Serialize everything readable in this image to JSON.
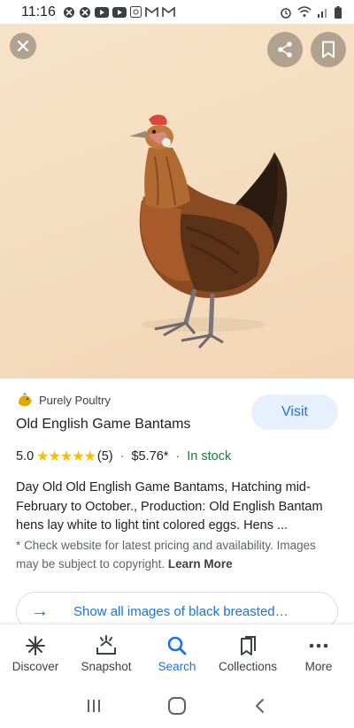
{
  "status_bar": {
    "time": "11:16",
    "left_icons": [
      "xbox-icon",
      "xbox-icon",
      "youtube-icon",
      "youtube-icon",
      "photo-icon",
      "gmail-icon",
      "gmail-icon"
    ],
    "right_icons": [
      "alarm-icon",
      "wifi-icon",
      "signal-icon",
      "battery-icon"
    ]
  },
  "image": {
    "subject": "hen-photo",
    "background_color": "#f5ddc0"
  },
  "result": {
    "source": "Purely Poultry",
    "title": "Old English Game Bantams",
    "visit_label": "Visit",
    "rating": "5.0",
    "stars": "★★★★★",
    "review_count": "(5)",
    "separator": "·",
    "price": "$5.76*",
    "availability": "In stock",
    "description": "Day Old Old English Game Bantams, Hatching mid-February to October., Production: Old English Bantam hens lay white to light tint colored eggs. Hens ...",
    "note": "* Check website for latest pricing and availability. Images may be subject to copyright.",
    "learn_more": "Learn More",
    "show_all": "Show all images of black breasted…"
  },
  "bottom_nav": {
    "items": [
      {
        "label": "Discover",
        "icon": "asterisk-icon"
      },
      {
        "label": "Snapshot",
        "icon": "snapshot-icon"
      },
      {
        "label": "Search",
        "icon": "search-icon"
      },
      {
        "label": "Collections",
        "icon": "collections-icon"
      },
      {
        "label": "More",
        "icon": "more-icon"
      }
    ],
    "active": "Search"
  },
  "colors": {
    "accent": "#1a73e8",
    "in_stock": "#188038",
    "stars": "#fbbc04"
  }
}
